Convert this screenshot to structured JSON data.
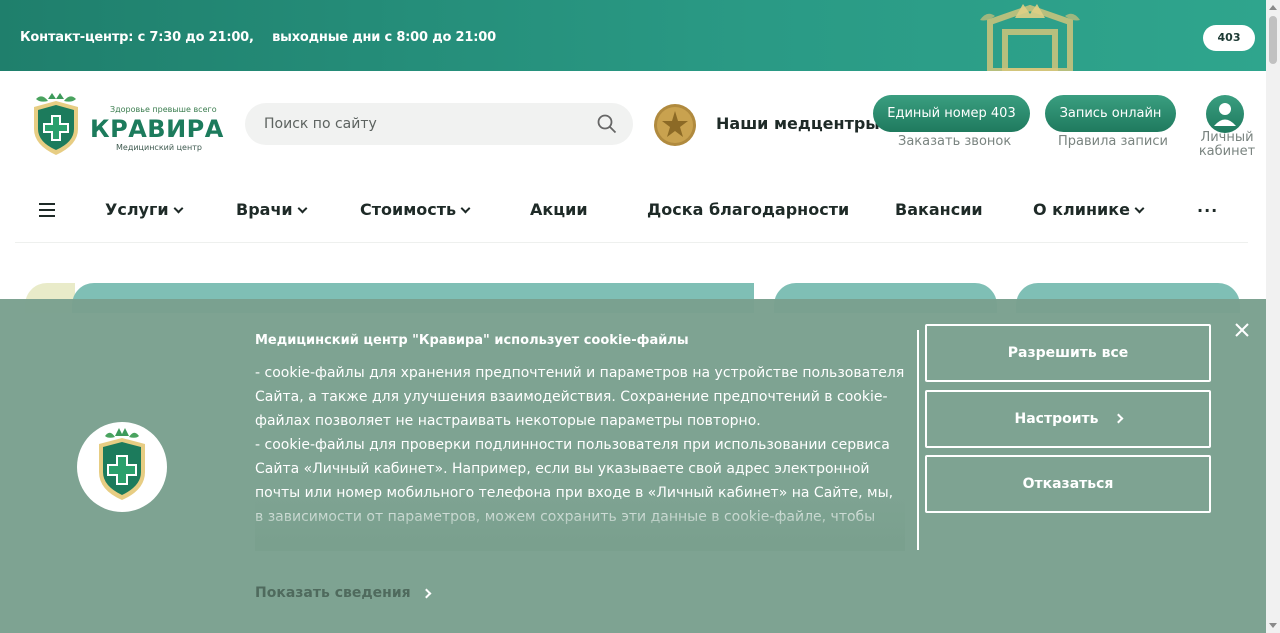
{
  "topbar": {
    "contact_hours": "Контакт-центр: с 7:30 до 21:00,",
    "weekend_hours": "выходные дни с 8:00 до 21:00",
    "phone_short": "403"
  },
  "header": {
    "logo": {
      "tagline": "Здоровье превыше всего",
      "brand": "КРАВИРА",
      "subtitle": "Медицинский центр"
    },
    "search": {
      "placeholder": "Поиск по сайту"
    },
    "medcenters_label": "Наши медцентры",
    "single_number_button": "Единый номер 403",
    "order_call_link": "Заказать звонок",
    "online_booking_button": "Запись онлайн",
    "booking_rules_link": "Правила записи",
    "cabinet_label_line1": "Личный",
    "cabinet_label_line2": "кабинет"
  },
  "nav": {
    "items": [
      {
        "label": "Услуги",
        "dropdown": true
      },
      {
        "label": "Врачи",
        "dropdown": true
      },
      {
        "label": "Стоимость",
        "dropdown": true
      },
      {
        "label": "Акции",
        "dropdown": false
      },
      {
        "label": "Доска благодарности",
        "dropdown": false
      },
      {
        "label": "Вакансии",
        "dropdown": false
      },
      {
        "label": "О клинике",
        "dropdown": true
      }
    ],
    "more": "..."
  },
  "cookie": {
    "title": "Медицинский центр \"Кравира\" использует cookie-файлы",
    "paragraph1": "- cookie-файлы для хранения предпочтений и параметров на устройстве пользователя Сайта, а также для улучшения взаимодействия. Сохранение предпочтений в cookie-файлах позволяет не настраивать некоторые параметры повторно.",
    "paragraph2": "- cookie-файлы для проверки подлинности пользователя при использовании сервиса Сайта «Личный кабинет». Например, если вы указываете свой адрес электронной почты или номер мобильного телефона при входе в «Личный кабинет» на Сайте, мы, в зависимости от параметров, можем сохранить эти данные в cookie-файле, чтобы",
    "show_details": "Показать сведения",
    "allow_all": "Разрешить все",
    "configure": "Настроить",
    "decline": "Отказаться"
  },
  "colors": {
    "topbar_green": "#1f7f6c",
    "brand_green": "#1c7b5c",
    "button_green": "#2a8c6e",
    "cookie_overlay": "#7aa08e",
    "text_dark": "#1e2a27"
  }
}
